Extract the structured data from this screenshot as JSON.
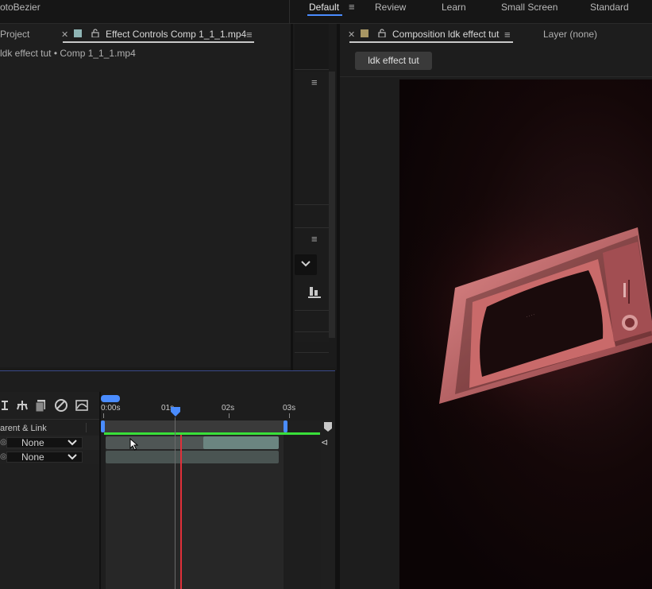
{
  "workspace": {
    "app_fragment": "otoBezier",
    "items": [
      "Default",
      "Review",
      "Learn",
      "Small Screen",
      "Standard"
    ],
    "active": "Default"
  },
  "left_panel": {
    "project_tab": "Project",
    "effect_controls_tab": "Effect Controls Comp 1_1_1.mp4",
    "breadcrumb": "ldk effect tut • Comp 1_1_1.mp4"
  },
  "composition_panel": {
    "tab": "Composition ldk effect tut",
    "layer_tab": "Layer (none)",
    "comp_button": "ldk effect tut"
  },
  "timeline": {
    "ruler": [
      "0:00s",
      "01s",
      "02s",
      "03s"
    ],
    "column_header": "arent & Link",
    "rows": [
      {
        "parent": "None"
      },
      {
        "parent": "None"
      }
    ]
  },
  "colors": {
    "accent_blue": "#4a8cff",
    "work_area_green": "#39e03a",
    "playhead_red": "#e0303a",
    "tv_body": "#c96a6a"
  },
  "icons": [
    "hamburger-icon",
    "close-icon",
    "lock-icon",
    "chevron-down-icon",
    "align-icon"
  ]
}
